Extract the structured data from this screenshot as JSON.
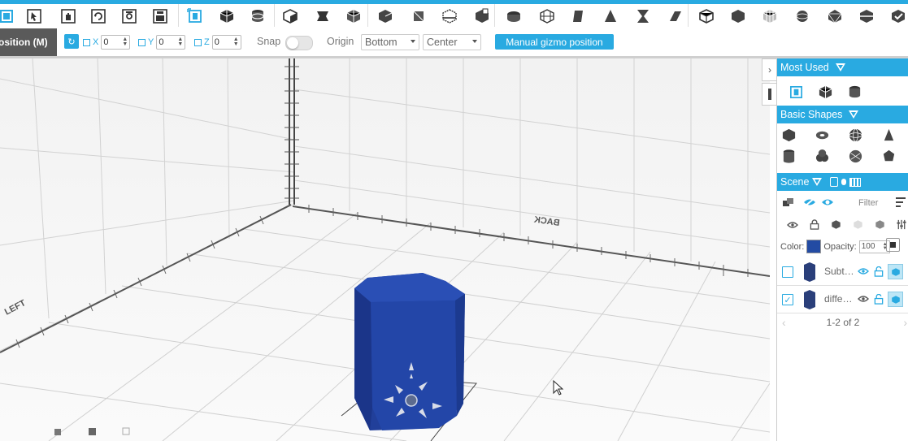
{
  "toolbar": {
    "accent_color": "#29aae1",
    "groups": [
      {
        "name": "camera",
        "icons": [
          "fit-view-icon",
          "select-cursor-icon",
          "pan-hand-icon",
          "orbit-icon",
          "screenshot-icon",
          "save-icon"
        ]
      },
      {
        "name": "transformations",
        "icons": [
          "transform-gizmo-icon",
          "box-icon",
          "cylinder-cut-icon"
        ]
      },
      {
        "name": "create",
        "icons": [
          "cube-create-icon",
          "cylinder-create-icon",
          "box-create-icon"
        ]
      },
      {
        "name": "boolean",
        "icons": [
          "boolean-cube-icon",
          "boolean-sphere-icon",
          "boolean-plane-icon",
          "boolean-subtract-icon"
        ]
      },
      {
        "name": "advanced",
        "icons": [
          "shell-icon",
          "grid-box-icon",
          "twist-icon",
          "cone-icon",
          "hourglass-icon",
          "slice-icon"
        ]
      },
      {
        "name": "tools",
        "icons": [
          "wireframe-box-icon",
          "solid-box-icon",
          "mesh-box-icon",
          "sphere-icon",
          "gem-icon",
          "split-box-icon",
          "check-box-icon"
        ]
      }
    ]
  },
  "subbar": {
    "mode_label": "osition (M)",
    "axes": [
      {
        "label": "X",
        "value": "0"
      },
      {
        "label": "Y",
        "value": "0"
      },
      {
        "label": "Z",
        "value": "0"
      }
    ],
    "snap_label": "Snap",
    "origin_label": "Origin",
    "origin_vertical": "Bottom",
    "origin_horizontal": "Center",
    "manual_gizmo_label": "Manual gizmo position"
  },
  "viewport": {
    "back_label": "BACK",
    "left_label": "LEFT",
    "object_color": "#234ba3"
  },
  "panel": {
    "most_used_title": "Most Used",
    "basic_shapes_title": "Basic Shapes",
    "scene_title": "Scene",
    "filter_placeholder": "Filter",
    "color_label": "Color:",
    "opacity_label": "Opacity:",
    "opacity_value": "100",
    "objects": [
      {
        "name": "Subt…",
        "checked": false
      },
      {
        "name": "diffe…",
        "checked": true
      }
    ],
    "pagination": "1-2 of 2"
  }
}
